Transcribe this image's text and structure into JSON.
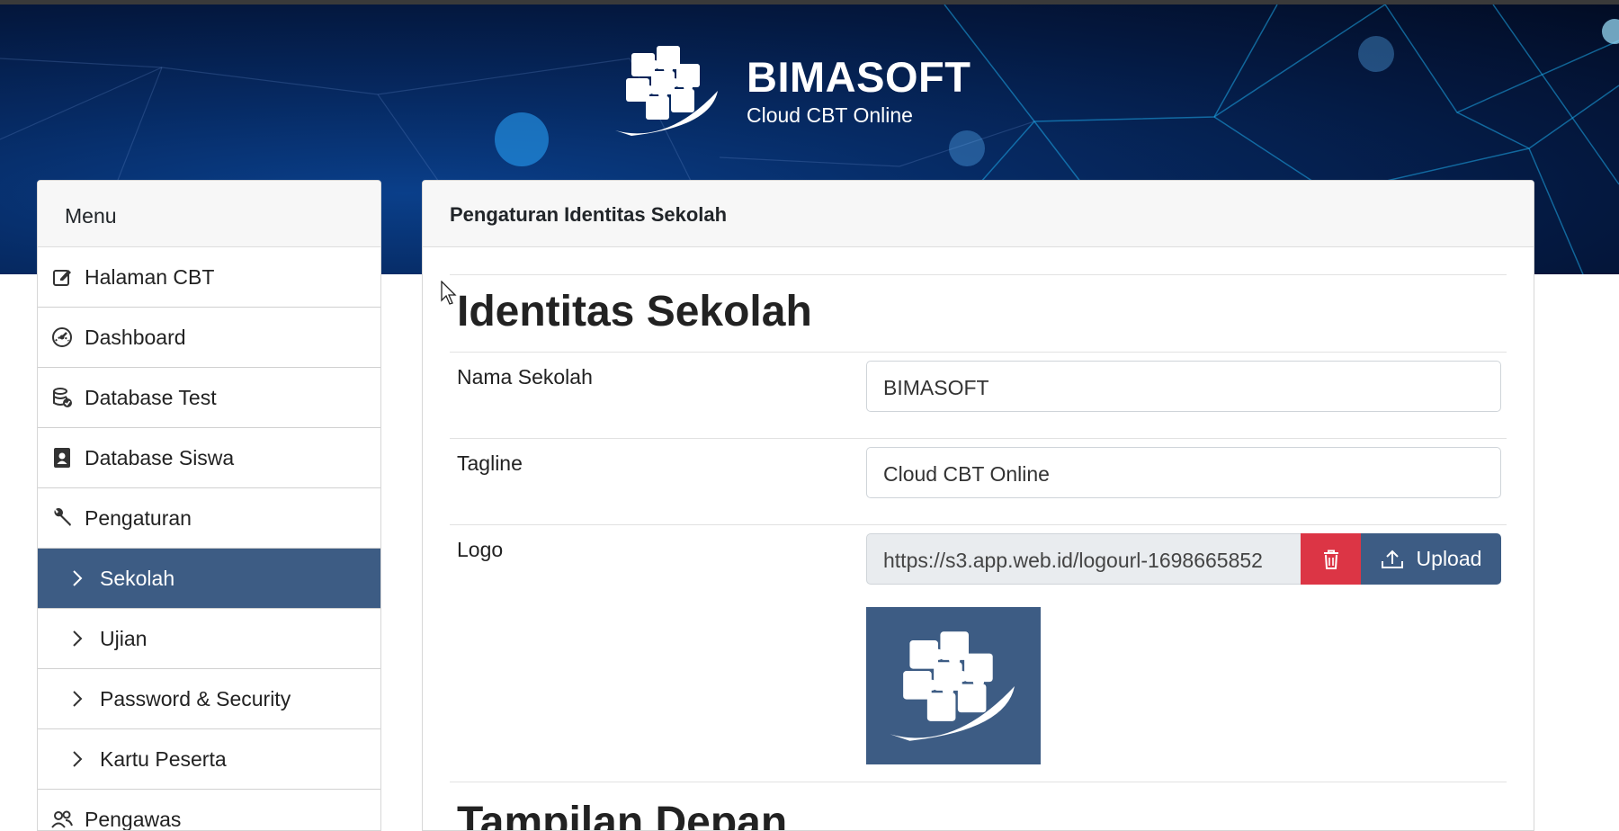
{
  "header": {
    "brand_name": "BIMASOFT",
    "brand_tagline": "Cloud CBT Online",
    "logo_icon": "puzzle-logo-icon"
  },
  "sidebar": {
    "title": "Menu",
    "items": [
      {
        "label": "Halaman CBT",
        "icon": "edit-icon"
      },
      {
        "label": "Dashboard",
        "icon": "gauge-icon"
      },
      {
        "label": "Database Test",
        "icon": "database-check-icon"
      },
      {
        "label": "Database Siswa",
        "icon": "id-badge-icon"
      },
      {
        "label": "Pengaturan",
        "icon": "wrench-icon"
      },
      {
        "label": "Sekolah",
        "icon": "chevron-right-icon",
        "active": true
      },
      {
        "label": "Ujian",
        "icon": "chevron-right-icon"
      },
      {
        "label": "Password & Security",
        "icon": "chevron-right-icon"
      },
      {
        "label": "Kartu Peserta",
        "icon": "chevron-right-icon"
      },
      {
        "label": "Pengawas",
        "icon": "users-icon"
      }
    ]
  },
  "panel": {
    "title": "Pengaturan Identitas Sekolah",
    "section1": "Identitas Sekolah",
    "nama_label": "Nama Sekolah",
    "nama_value": "BIMASOFT",
    "tagline_label": "Tagline",
    "tagline_value": "Cloud CBT Online",
    "logo_label": "Logo",
    "logo_url": "https://s3.app.web.id/logourl-1698665852",
    "upload_label": "Upload",
    "section2": "Tampilan Depan"
  },
  "colors": {
    "primary": "#3d5c84",
    "danger": "#dc3545",
    "banner": "#062a63"
  }
}
